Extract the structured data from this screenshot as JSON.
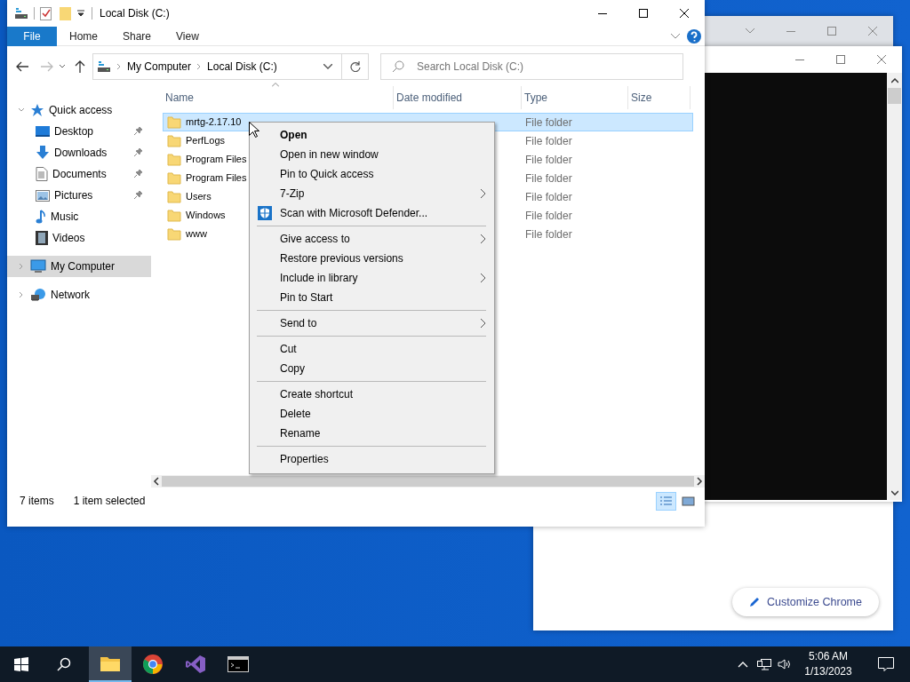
{
  "explorer": {
    "title": "Local Disk (C:)",
    "ribbon_tabs": [
      {
        "label": "File",
        "kind": "file"
      },
      {
        "label": "Home",
        "kind": "tab"
      },
      {
        "label": "Share",
        "kind": "tab"
      },
      {
        "label": "View",
        "kind": "tab"
      }
    ],
    "breadcrumbs": [
      "My Computer",
      "Local Disk (C:)"
    ],
    "search": {
      "placeholder": "Search Local Disk (C:)"
    },
    "navigation": [
      {
        "label": "Quick access",
        "kind": "quick",
        "expanded": true,
        "selected": false,
        "children": [
          {
            "label": "Desktop",
            "kind": "desktop",
            "pinned": true,
            "selected": false
          },
          {
            "label": "Downloads",
            "kind": "downloads",
            "pinned": true,
            "selected": false
          },
          {
            "label": "Documents",
            "kind": "documents",
            "pinned": true,
            "selected": false
          },
          {
            "label": "Pictures",
            "kind": "pictures",
            "pinned": true,
            "selected": false
          },
          {
            "label": "Music",
            "kind": "music",
            "pinned": false,
            "selected": false
          },
          {
            "label": "Videos",
            "kind": "videos",
            "pinned": false,
            "selected": false
          }
        ]
      },
      {
        "label": "My Computer",
        "kind": "computer",
        "expanded": false,
        "selected": true
      },
      {
        "label": "Network",
        "kind": "network",
        "expanded": false,
        "selected": false
      }
    ],
    "columns": [
      "Name",
      "Date modified",
      "Type",
      "Size"
    ],
    "rows": [
      {
        "name": "mrtg-2.17.10",
        "type": "File folder",
        "selected": true
      },
      {
        "name": "PerfLogs",
        "type": "File folder",
        "selected": false
      },
      {
        "name": "Program Files",
        "type": "File folder",
        "selected": false
      },
      {
        "name": "Program Files",
        "type": "File folder",
        "selected": false
      },
      {
        "name": "Users",
        "type": "File folder",
        "selected": false
      },
      {
        "name": "Windows",
        "type": "File folder",
        "selected": false
      },
      {
        "name": "www",
        "type": "File folder",
        "selected": false
      }
    ],
    "status": {
      "items": "7 items",
      "selection": "1 item selected"
    },
    "view_modes": [
      {
        "kind": "details",
        "selected": true
      },
      {
        "kind": "thumbnails",
        "selected": false
      }
    ]
  },
  "context_menu": {
    "groups": [
      [
        {
          "label": "Open",
          "bold": true,
          "submenu": false,
          "kind": "plain"
        },
        {
          "label": "Open in new window",
          "bold": false,
          "submenu": false,
          "kind": "plain"
        },
        {
          "label": "Pin to Quick access",
          "bold": false,
          "submenu": false,
          "kind": "plain"
        },
        {
          "label": "7-Zip",
          "bold": false,
          "submenu": true,
          "kind": "plain"
        },
        {
          "label": "Scan with Microsoft Defender...",
          "bold": false,
          "submenu": false,
          "kind": "shield"
        }
      ],
      [
        {
          "label": "Give access to",
          "bold": false,
          "submenu": true,
          "kind": "plain"
        },
        {
          "label": "Restore previous versions",
          "bold": false,
          "submenu": false,
          "kind": "plain"
        },
        {
          "label": "Include in library",
          "bold": false,
          "submenu": true,
          "kind": "plain"
        },
        {
          "label": "Pin to Start",
          "bold": false,
          "submenu": false,
          "kind": "plain"
        }
      ],
      [
        {
          "label": "Send to",
          "bold": false,
          "submenu": true,
          "kind": "plain"
        }
      ],
      [
        {
          "label": "Cut",
          "bold": false,
          "submenu": false,
          "kind": "plain"
        },
        {
          "label": "Copy",
          "bold": false,
          "submenu": false,
          "kind": "plain"
        }
      ],
      [
        {
          "label": "Create shortcut",
          "bold": false,
          "submenu": false,
          "kind": "plain"
        },
        {
          "label": "Delete",
          "bold": false,
          "submenu": false,
          "kind": "plain"
        },
        {
          "label": "Rename",
          "bold": false,
          "submenu": false,
          "kind": "plain"
        }
      ],
      [
        {
          "label": "Properties",
          "bold": false,
          "submenu": false,
          "kind": "plain"
        }
      ]
    ]
  },
  "browser": {
    "button": "Customize Chrome"
  },
  "taskbar": {
    "apps": [
      {
        "kind": "explorer",
        "active": true
      },
      {
        "kind": "chrome",
        "active": false
      },
      {
        "kind": "studio",
        "active": false
      },
      {
        "kind": "terminal",
        "active": false
      }
    ],
    "time": "5:06 AM",
    "date": "1/13/2023"
  }
}
